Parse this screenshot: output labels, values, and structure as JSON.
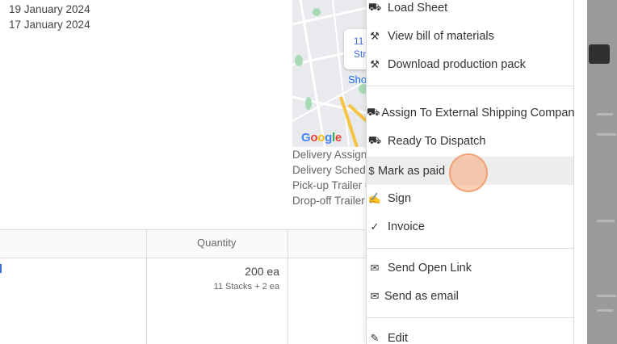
{
  "dates": [
    "19 January 2024",
    "17 January 2024"
  ],
  "map": {
    "bubble_line1": "11",
    "bubble_line2": "Str",
    "place_label": "Sho",
    "logo": "Google"
  },
  "delivery_labels": [
    "Delivery Assigne",
    "Delivery Schedu",
    "Pick-up Trailer #",
    "Drop-off Trailer"
  ],
  "table": {
    "headers": [
      "Quantity"
    ],
    "rows": [
      {
        "quantity": "200 ea",
        "quantity_detail": "11 Stacks + 2 ea"
      }
    ]
  },
  "menu": {
    "groups": [
      [
        {
          "icon": "truck-load-icon",
          "label": "Load Sheet"
        },
        {
          "icon": "hammer-icon",
          "label": "View bill of materials"
        },
        {
          "icon": "hammer-icon",
          "label": "Download production pack"
        }
      ],
      [
        {
          "icon": "shipping-truck-icon",
          "label": "Assign To External Shipping Company"
        },
        {
          "icon": "truck-load-icon",
          "label": "Ready To Dispatch"
        },
        {
          "icon": "dollar-icon",
          "label": "Mark as paid",
          "highlighted": true
        },
        {
          "icon": "signature-icon",
          "label": "Sign"
        },
        {
          "icon": "check-icon",
          "label": "Invoice"
        }
      ],
      [
        {
          "icon": "envelope-icon",
          "label": "Send Open Link"
        },
        {
          "icon": "envelope-icon",
          "label": "Send as email"
        }
      ],
      [
        {
          "icon": "edit-icon",
          "label": "Edit"
        }
      ]
    ]
  }
}
